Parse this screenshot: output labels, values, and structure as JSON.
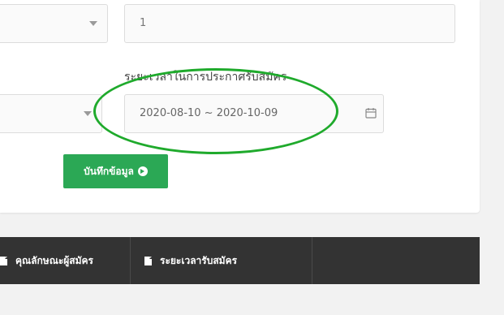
{
  "form": {
    "quantity_value": "1",
    "date_label": "ระยะเวลาในการประกาศรับสมัคร",
    "date_range_value": "2020-08-10 ~ 2020-10-09",
    "save_label": "บันทึกข้อมูล"
  },
  "tabs": [
    {
      "label": "คุณลักษณะผู้สมัคร"
    },
    {
      "label": "ระยะเวลารับสมัคร"
    }
  ],
  "colors": {
    "accent": "#2ba855",
    "highlight_ellipse": "#1faa2c",
    "tabbar_bg": "#333333"
  }
}
